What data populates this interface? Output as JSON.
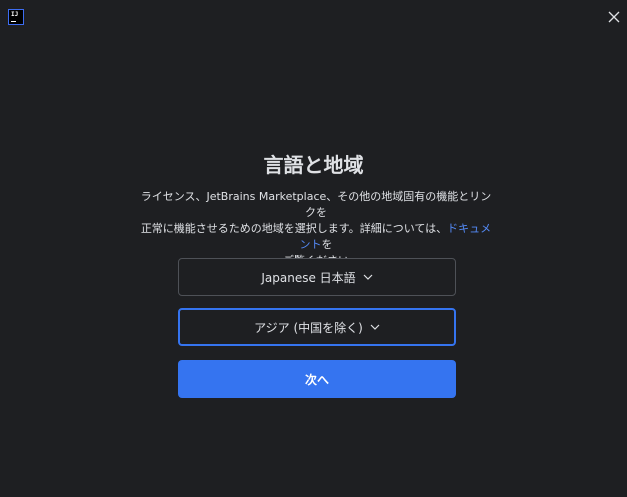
{
  "app": {
    "logo_text": "IJ"
  },
  "dialog": {
    "title": "言語と地域",
    "description_line1": "ライセンス、JetBrains Marketplace、その他の地域固有の機能とリンクを",
    "description_line2_prefix": "正常に機能させるための地域を選択します。詳細については、",
    "description_link": "ドキュメント",
    "description_line2_suffix": "を",
    "description_line3": "ご覧ください"
  },
  "language_select": {
    "selected": "Japanese 日本語"
  },
  "region_select": {
    "selected": "アジア (中国を除く)"
  },
  "next_button": {
    "label": "次へ"
  },
  "colors": {
    "background": "#1e1f22",
    "accent": "#3574f0",
    "link": "#548af7",
    "text": "#dfe1e5",
    "border": "#4e5157"
  }
}
